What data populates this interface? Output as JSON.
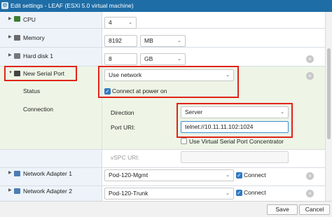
{
  "window": {
    "title": "Edit settings - LEAF (ESXi 5.0 virtual machine)"
  },
  "rows": {
    "cpu": {
      "label": "CPU",
      "value": "4"
    },
    "memory": {
      "label": "Memory",
      "value": "8192",
      "unit": "MB"
    },
    "hard_disk": {
      "label": "Hard disk 1",
      "value": "8",
      "unit": "GB"
    },
    "serial_port": {
      "label": "New Serial Port",
      "type": "Use network",
      "status_label": "Status",
      "connect_label": "Connect at power on",
      "connect_checked": true,
      "connection_label": "Connection",
      "direction_label": "Direction",
      "direction_value": "Server",
      "port_uri_label": "Port URI:",
      "port_uri_value": "telnet://10.11.11.102:1024",
      "concentrator_label": "Use Virtual Serial Port Concentrator",
      "concentrator_checked": false,
      "vspc_uri_label": "vSPC URI:",
      "vspc_uri_value": ""
    },
    "network_adapter_1": {
      "label": "Network Adapter 1",
      "value": "Pod-120-Mgmt",
      "connect_label": "Connect",
      "connect_checked": true
    },
    "network_adapter_2": {
      "label": "Network Adapter 2",
      "value": "Pod-120-Trunk",
      "connect_label": "Connect",
      "connect_checked": true
    }
  },
  "footer": {
    "save_label": "Save",
    "cancel_label": "Cancel"
  },
  "colors": {
    "titlebar": "#1e6da6",
    "highlight_box": "#e0241a",
    "checkbox": "#2f79c3",
    "selected_row": "#eef5e6"
  }
}
